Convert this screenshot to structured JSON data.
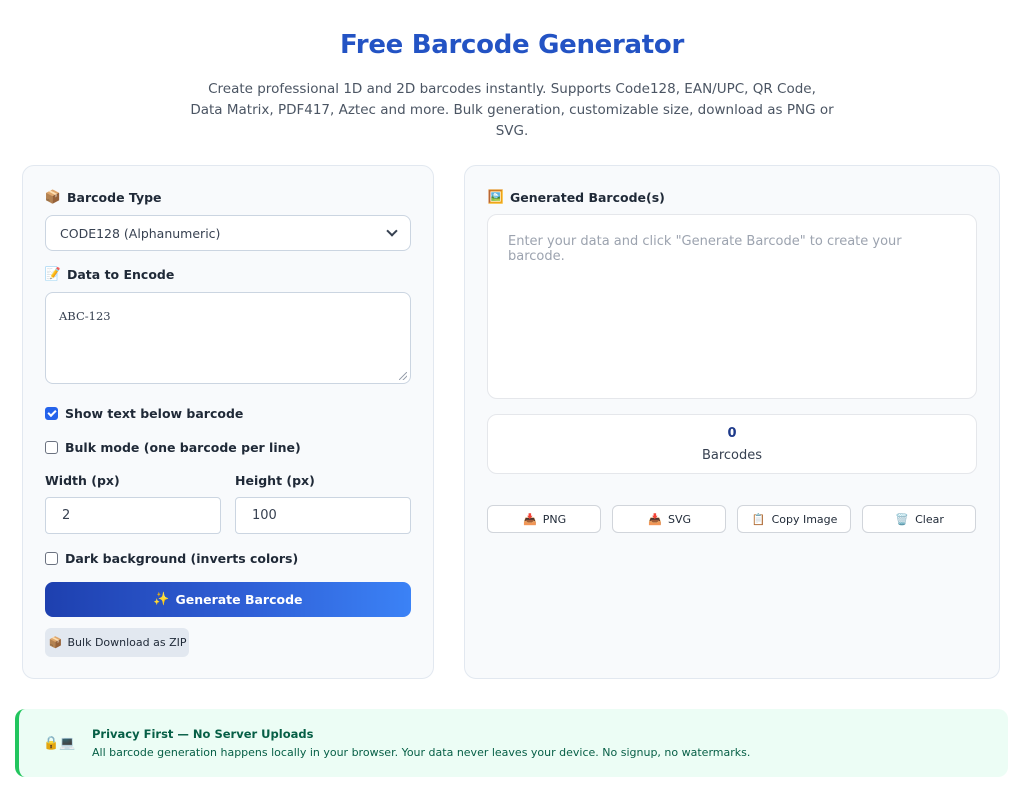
{
  "header": {
    "title": "Free Barcode Generator",
    "subtitle": "Create professional 1D and 2D barcodes instantly. Supports Code128, EAN/UPC, QR Code, Data Matrix, PDF417, Aztec and more. Bulk generation, customizable size, download as PNG or SVG."
  },
  "form": {
    "barcode_type_label": "Barcode Type",
    "barcode_type_icon": "package-icon",
    "barcode_type_value": "CODE128 (Alphanumeric)",
    "data_label": "Data to Encode",
    "data_icon": "memo-icon",
    "data_value": "ABC-123",
    "show_text_label": "Show text below barcode",
    "show_text_checked": true,
    "bulk_mode_label": "Bulk mode (one barcode per line)",
    "bulk_mode_checked": false,
    "width_label": "Width (px)",
    "width_value": "2",
    "height_label": "Height (px)",
    "height_value": "100",
    "dark_bg_label": "Dark background (inverts colors)",
    "dark_bg_checked": false,
    "generate_label": "Generate Barcode",
    "generate_icon": "sparkles-icon",
    "zip_label": "Bulk Download as ZIP",
    "zip_icon": "package-icon"
  },
  "output": {
    "title": "Generated Barcode(s)",
    "title_icon": "framed-picture-icon",
    "placeholder": "Enter your data and click \"Generate Barcode\" to create your barcode.",
    "count": "0",
    "count_label": "Barcodes",
    "actions": [
      {
        "label": "PNG",
        "icon": "download-tray-icon"
      },
      {
        "label": "SVG",
        "icon": "download-tray-icon"
      },
      {
        "label": "Copy Image",
        "icon": "clipboard-icon"
      },
      {
        "label": "Clear",
        "icon": "trash-icon"
      }
    ]
  },
  "privacy": {
    "title": "Privacy First — No Server Uploads",
    "text": "All barcode generation happens locally in your browser. Your data never leaves your device. No signup, no watermarks.",
    "accent": "#22c55e"
  },
  "colors": {
    "brand": "#2353c4",
    "primary_button": "#2f5fd6"
  }
}
